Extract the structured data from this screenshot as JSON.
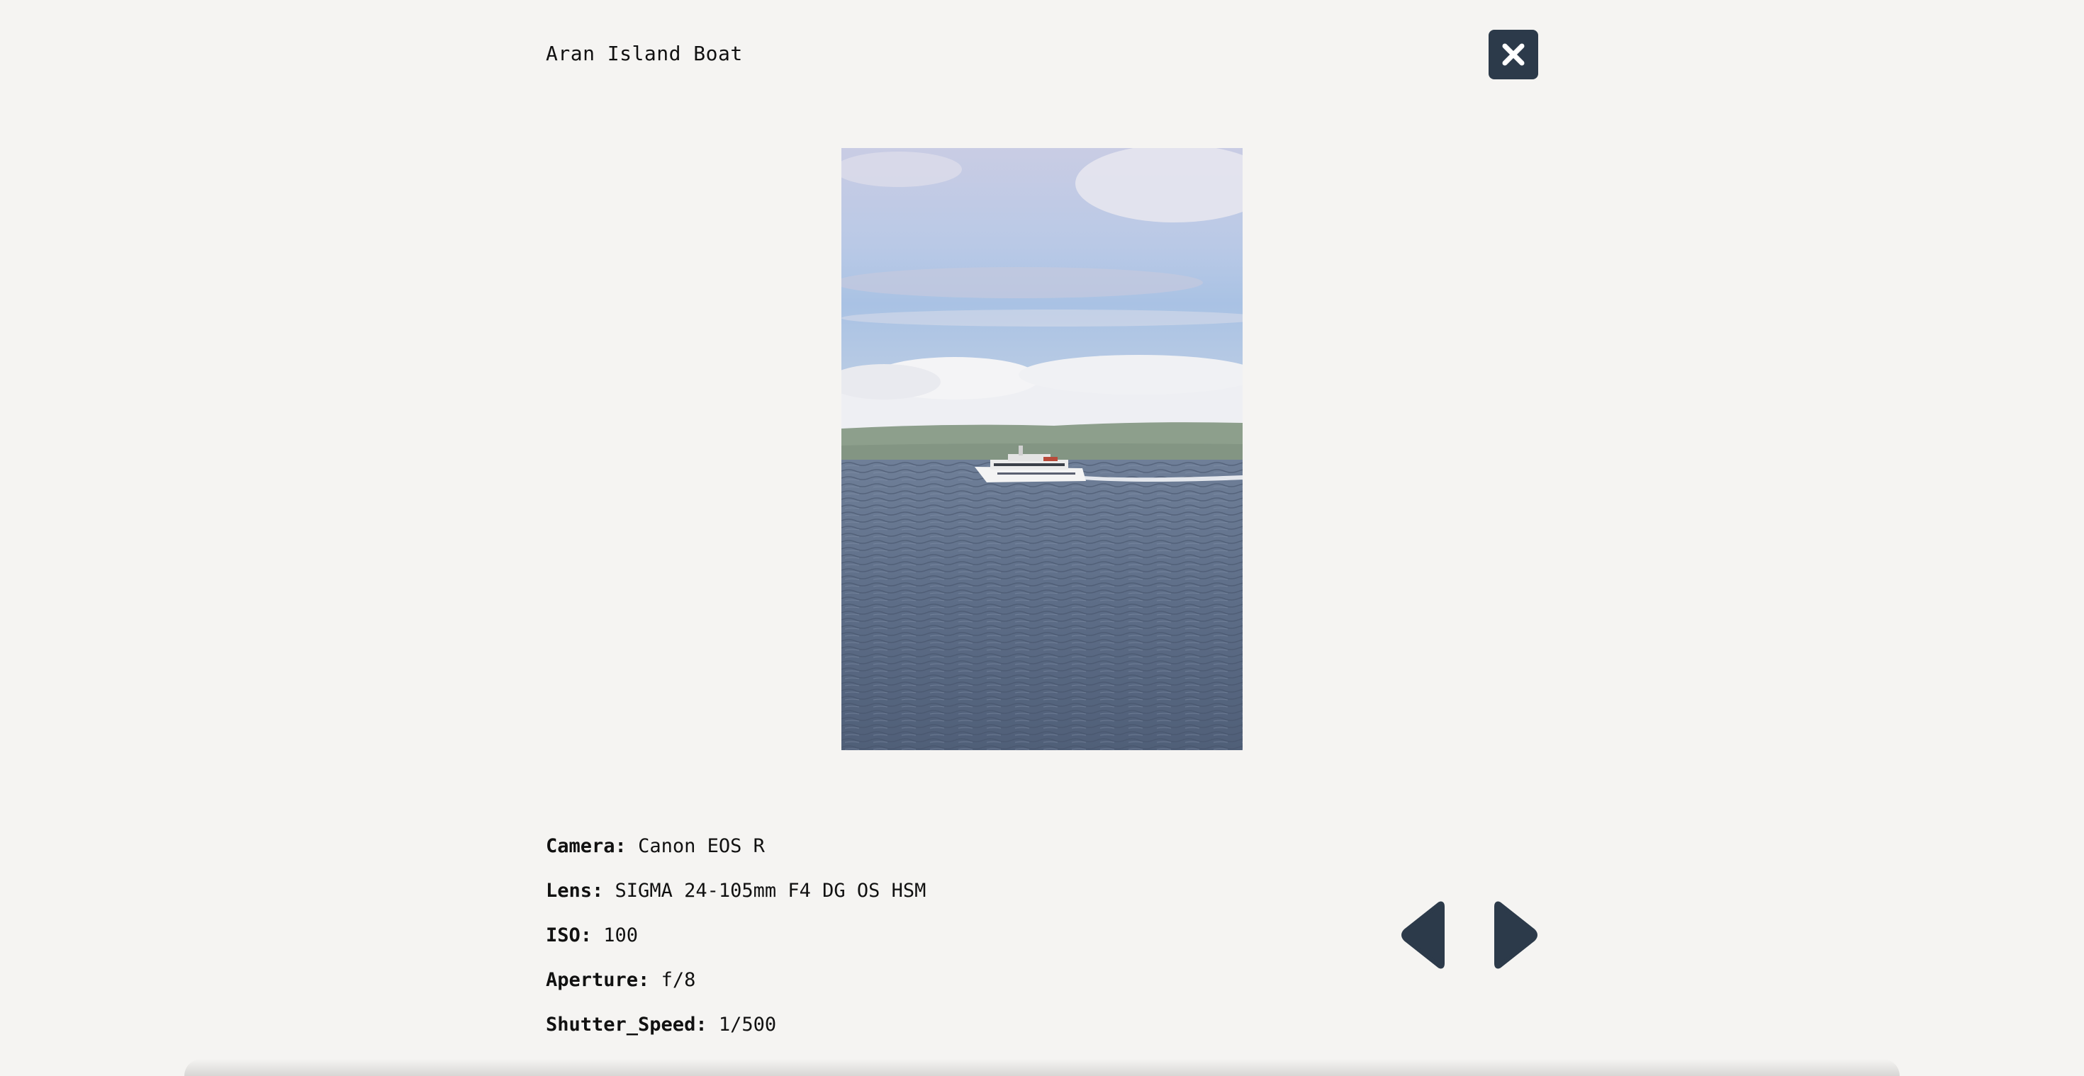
{
  "photo": {
    "title": "Aran Island Boat",
    "image_alt": "Aran Island Boat"
  },
  "metadata": [
    {
      "key": "Camera:",
      "value": "Canon EOS R"
    },
    {
      "key": "Lens:",
      "value": "SIGMA 24-105mm F4 DG OS HSM"
    },
    {
      "key": "ISO:",
      "value": "100"
    },
    {
      "key": "Aperture:",
      "value": "f/8"
    },
    {
      "key": "Shutter_Speed:",
      "value": "1/500"
    }
  ],
  "controls": {
    "close_icon": "close-icon",
    "prev_icon": "chevron-left-icon",
    "next_icon": "chevron-right-icon"
  },
  "colors": {
    "background": "#f5f4f2",
    "button": "#2c3a4a",
    "text": "#111111"
  }
}
